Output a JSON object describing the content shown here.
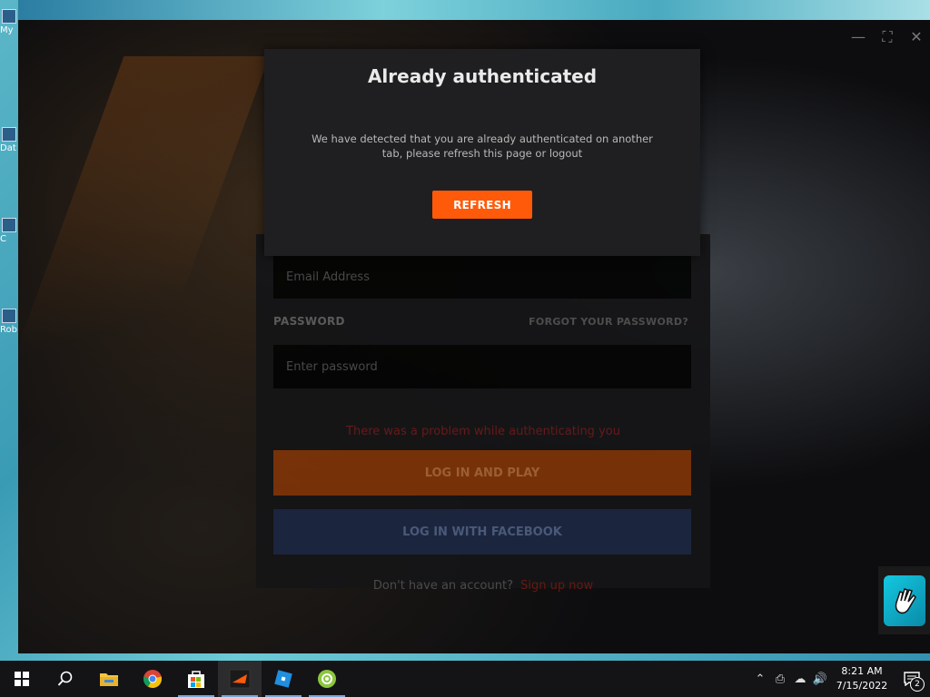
{
  "desktop": {
    "icons": [
      {
        "label": "My",
        "icon": "this-pc-icon"
      },
      {
        "label": "Dat",
        "icon": "folder-icon"
      },
      {
        "label": "C",
        "icon": "app-icon"
      },
      {
        "label": "Rob",
        "icon": "roblox-icon"
      }
    ]
  },
  "window": {
    "controls": [
      "minimize",
      "maximize",
      "close"
    ]
  },
  "modal": {
    "title": "Already authenticated",
    "message": "We have detected that you are already authenticated on another tab, please refresh this page or logout",
    "refresh_label": "REFRESH",
    "accent": "#ff5a0a"
  },
  "login": {
    "email_placeholder": "Email Address",
    "password_label": "PASSWORD",
    "forgot_label": "FORGOT YOUR PASSWORD?",
    "password_placeholder": "Enter password",
    "error": "There was a problem while authenticating you",
    "play_label": "LOG IN AND PLAY",
    "facebook_label": "LOG IN WITH FACEBOOK",
    "no_account": "Don't have an account?",
    "signup_label": "Sign up now"
  },
  "taskbar": {
    "apps": [
      "start-icon",
      "search-icon",
      "file-explorer-icon",
      "chrome-icon",
      "store-icon",
      "game-launcher-icon",
      "roblox-icon",
      "camera-app-icon"
    ],
    "time": "8:21 AM",
    "date": "7/15/2022",
    "notification_count": "2"
  }
}
